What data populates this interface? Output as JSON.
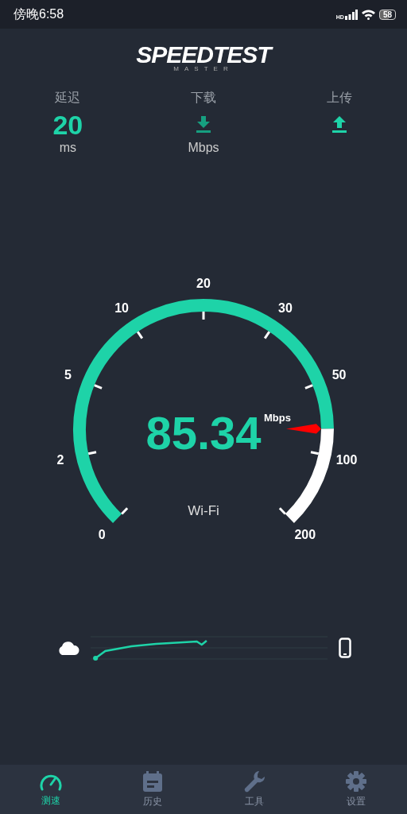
{
  "status_bar": {
    "time": "傍晚6:58",
    "network": "HD",
    "battery": "58"
  },
  "logo": {
    "title": "SPEEDTEST",
    "subtitle": "MASTER"
  },
  "metrics": [
    {
      "kind": "ping",
      "label": "延迟",
      "value": "20",
      "unit": "ms"
    },
    {
      "kind": "download",
      "label": "下载",
      "unit": "Mbps"
    },
    {
      "kind": "upload",
      "label": "上传"
    }
  ],
  "gauge": {
    "ticks": [
      "0",
      "2",
      "5",
      "10",
      "20",
      "30",
      "50",
      "100",
      "200"
    ],
    "reading": "85.34",
    "unit": "Mbps",
    "connection": "Wi-Fi"
  },
  "nav": [
    {
      "kind": "speed",
      "label": "测速",
      "selected": true
    },
    {
      "kind": "history",
      "label": "历史",
      "selected": false
    },
    {
      "kind": "tools",
      "label": "工具",
      "selected": false
    },
    {
      "kind": "settings",
      "label": "设置",
      "selected": false
    }
  ]
}
